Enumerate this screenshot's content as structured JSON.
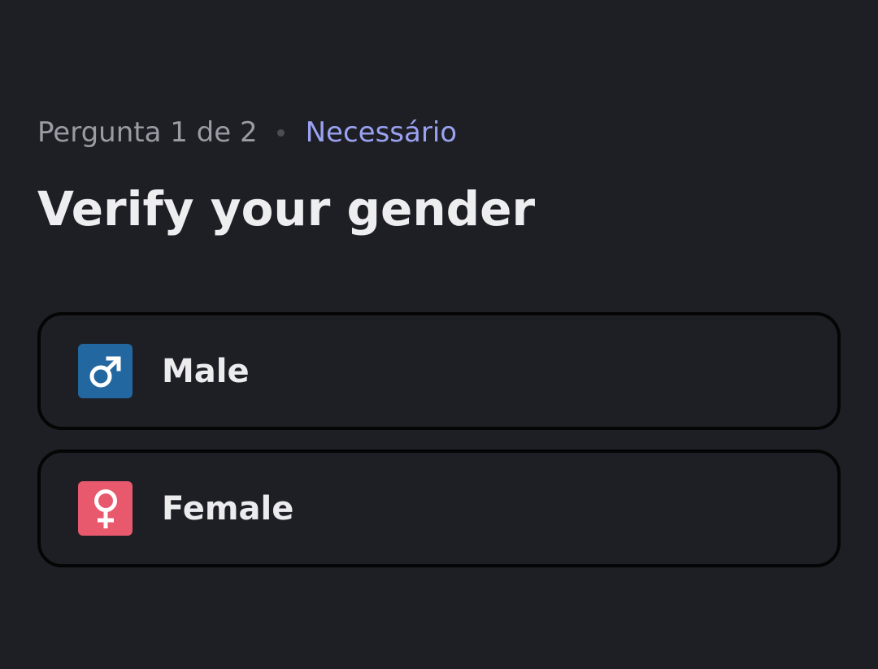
{
  "header": {
    "question_count": "Pergunta 1 de 2",
    "required_label": "Necessário"
  },
  "question": {
    "title": "Verify your gender"
  },
  "options": [
    {
      "label": "Male",
      "icon": "male-sign-icon",
      "icon_bg": "#22679f"
    },
    {
      "label": "Female",
      "icon": "female-sign-icon",
      "icon_bg": "#e8596e"
    }
  ],
  "colors": {
    "background": "#1e1f24",
    "muted_text": "#9a9ba3",
    "accent": "#9aa2f2",
    "title_text": "#eeeef0",
    "option_border": "#050506"
  }
}
